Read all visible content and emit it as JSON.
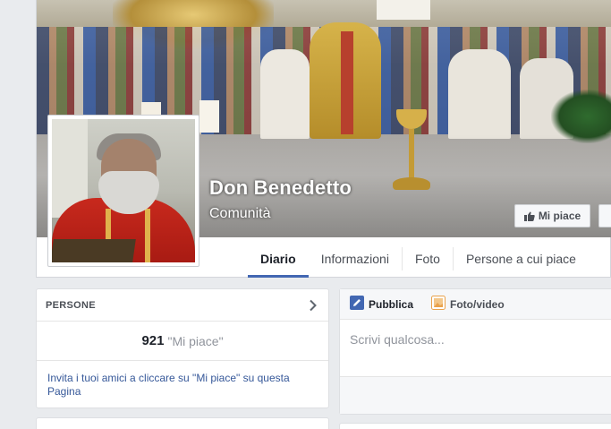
{
  "page": {
    "name": "Don Benedetto",
    "category": "Comunità"
  },
  "actions": {
    "like_label": "Mi piace"
  },
  "tabs": [
    {
      "label": "Diario",
      "active": true
    },
    {
      "label": "Informazioni",
      "active": false
    },
    {
      "label": "Foto",
      "active": false
    },
    {
      "label": "Persone a cui piace",
      "active": false
    }
  ],
  "people": {
    "title": "PERSONE",
    "likes_count": "921",
    "likes_label": "\"Mi piace\"",
    "invite_text": "Invita i tuoi amici a cliccare su \"Mi piace\" su questa Pagina"
  },
  "composer": {
    "tabs": [
      {
        "label": "Pubblica",
        "icon": "pencil-icon",
        "color": "#4267b2"
      },
      {
        "label": "Foto/video",
        "icon": "photo-icon",
        "color": "#e9a24c"
      }
    ],
    "placeholder": "Scrivi qualcosa..."
  },
  "colors": {
    "accent": "#4267b2",
    "link": "#365899",
    "background": "#e9ebee"
  }
}
